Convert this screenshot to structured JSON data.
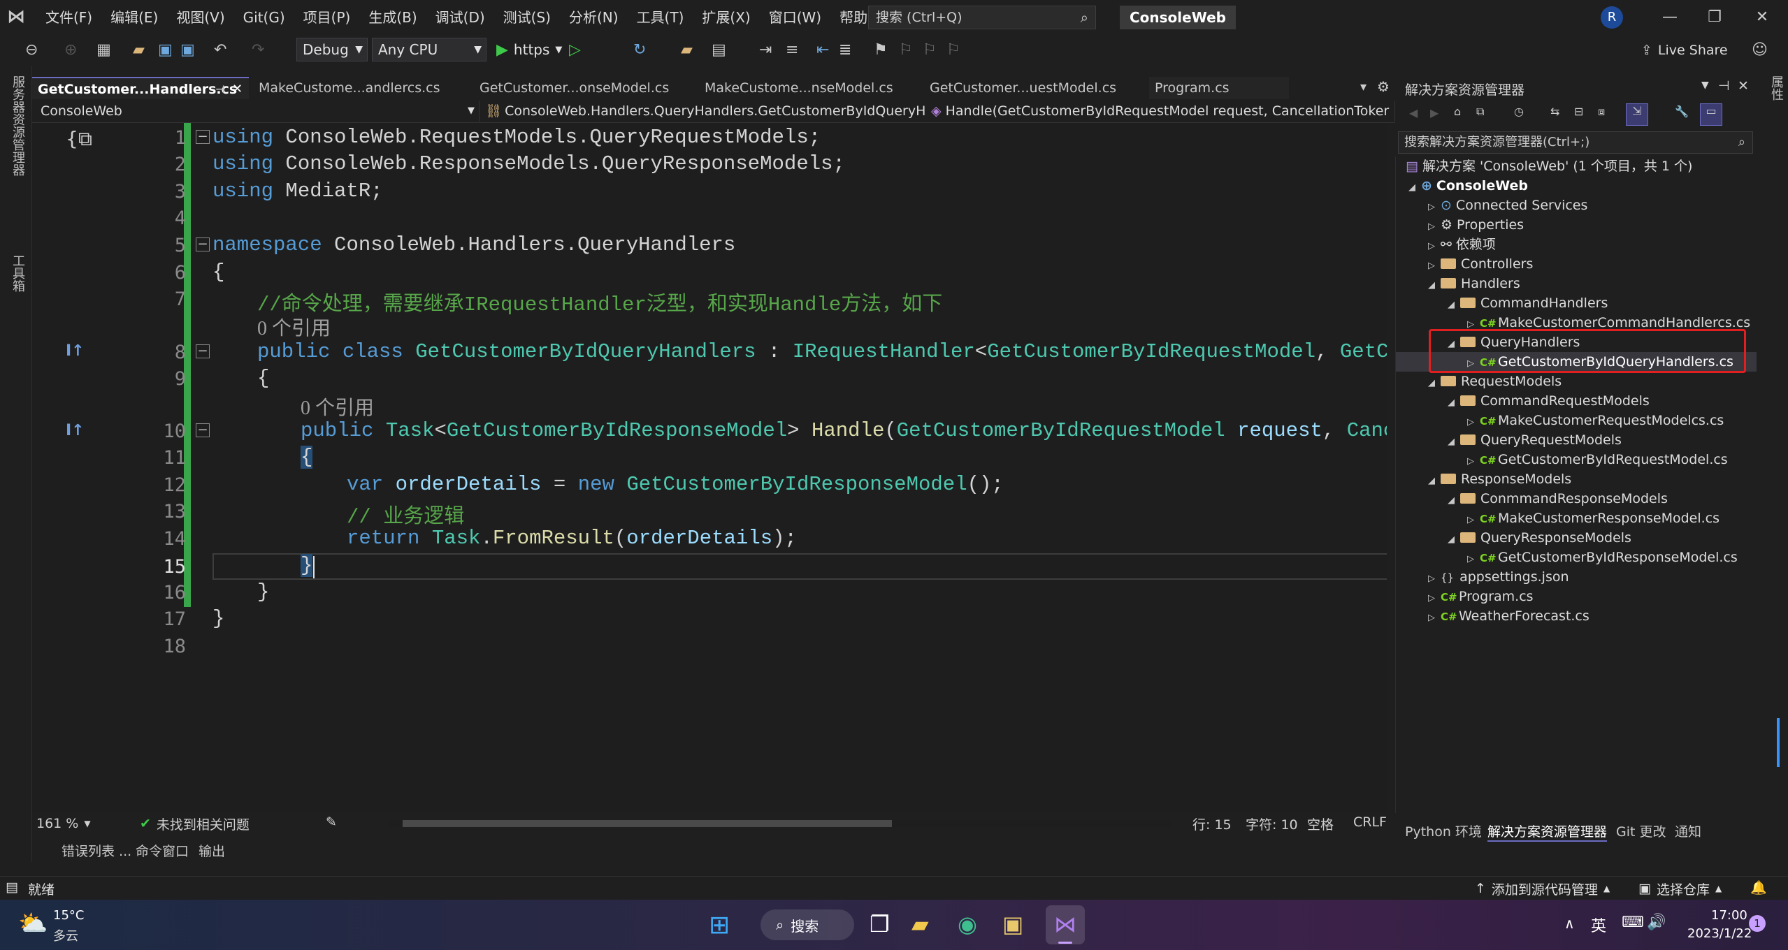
{
  "menubar": {
    "items": [
      "文件(F)",
      "编辑(E)",
      "视图(V)",
      "Git(G)",
      "项目(P)",
      "生成(B)",
      "调试(D)",
      "测试(S)",
      "分析(N)",
      "工具(T)",
      "扩展(X)",
      "窗口(W)",
      "帮助(H)"
    ],
    "search_placeholder": "搜索 (Ctrl+Q)",
    "solution_name": "ConsoleWeb",
    "avatar_letter": "R",
    "live_share": "Live Share"
  },
  "toolbar": {
    "config": "Debug",
    "platform": "Any CPU",
    "run_target": "https"
  },
  "left_strip": {
    "item1": "服务器资源管理器",
    "item2": "工具箱"
  },
  "right_strip": {
    "item1": "属性"
  },
  "tabs": [
    {
      "label": "GetCustomer...Handlers.cs"
    },
    {
      "label": "MakeCustome...andlercs.cs"
    },
    {
      "label": "GetCustomer...onseModel.cs"
    },
    {
      "label": "MakeCustome...nseModel.cs"
    },
    {
      "label": "GetCustomer...uestModel.cs"
    },
    {
      "label": "Program.cs"
    }
  ],
  "navbar": {
    "project": "ConsoleWeb",
    "type": "ConsoleWeb.Handlers.QueryHandlers.GetCustomerByIdQueryHand",
    "member": "Handle(GetCustomerByIdRequestModel request, CancellationToker"
  },
  "editor": {
    "line_numbers": [
      "1",
      "2",
      "3",
      "4",
      "5",
      "6",
      "7",
      "8",
      "9",
      "10",
      "11",
      "12",
      "13",
      "14",
      "15",
      "16",
      "17",
      "18"
    ],
    "current_line": "15",
    "ref_count_label": "0 个引用",
    "code": {
      "l1_kw": "using",
      "l1_rest": " ConsoleWeb.RequestModels.QueryRequestModels;",
      "l2_kw": "using",
      "l2_rest": " ConsoleWeb.ResponseModels.QueryResponseModels;",
      "l3_kw": "using",
      "l3_rest": " MediatR;",
      "l5_kw": "namespace",
      "l5_rest": " ConsoleWeb.Handlers.QueryHandlers",
      "l6": "{",
      "l7": "//命令处理，需要继承IRequestHandler泛型，和实现Handle方法，如下",
      "l8_kw1": "public",
      "l8_kw2": " class ",
      "l8_name": "GetCustomerByIdQueryHandlers",
      "l8_sep": " : ",
      "l8_if": "IRequestHandler",
      "l8_lt": "<",
      "l8_t1": "GetCustomerByIdRequestModel",
      "l8_comma": ", ",
      "l8_t2": "GetCustomerB",
      "l9": "{",
      "l10_kw": "public",
      "l10_sp": " ",
      "l10_task": "Task",
      "l10_lt": "<",
      "l10_resp": "GetCustomerByIdResponseModel",
      "l10_gt": "> ",
      "l10_method": "Handle",
      "l10_paren": "(",
      "l10_req": "GetCustomerByIdRequestModel",
      "l10_param": " request",
      "l10_comma": ", ",
      "l10_ct": "Cancellatio",
      "l11": "{",
      "l12_kw": "var",
      "l12_var": " orderDetails",
      "l12_eq": " = ",
      "l12_new": "new",
      "l12_sp": " ",
      "l12_type": "GetCustomerByIdResponseModel",
      "l12_end": "();",
      "l13": "// 业务逻辑",
      "l14_kw": "return",
      "l14_sp": " ",
      "l14_task": "Task",
      "l14_dot": ".",
      "l14_method": "FromResult",
      "l14_open": "(",
      "l14_arg": "orderDetails",
      "l14_end": ");",
      "l15": "}",
      "l16": "}",
      "l17": "}"
    }
  },
  "editor_status": {
    "zoom": "161 %",
    "issues": "未找到相关问题",
    "line": "行: 15",
    "col": "字符: 10",
    "whitespace": "空格",
    "eol": "CRLF"
  },
  "bottom_tabs": [
    "错误列表 ...",
    "命令窗口",
    "输出"
  ],
  "solution_explorer": {
    "title": "解决方案资源管理器",
    "search_placeholder": "搜索解决方案资源管理器(Ctrl+;)",
    "solution_label": "解决方案 'ConsoleWeb' (1 个项目，共 1 个)",
    "project": "ConsoleWeb",
    "nodes": [
      "Connected Services",
      "Properties",
      "依赖项",
      "Controllers",
      "Handlers",
      "CommandHandlers",
      "MakeCustomerCommandHandlercs.cs",
      "QueryHandlers",
      "GetCustomerByIdQueryHandlers.cs",
      "RequestModels",
      "CommandRequestModels",
      "MakeCustomerRequestModelcs.cs",
      "QueryRequestModels",
      "GetCustomerByIdRequestModel.cs",
      "ResponseModels",
      "ConmmandResponseModels",
      "MakeCustomerResponseModel.cs",
      "QueryResponseModels",
      "GetCustomerByIdResponseModel.cs",
      "appsettings.json",
      "Program.cs",
      "WeatherForecast.cs"
    ],
    "cs_prefix": "C#",
    "bottom_tabs": [
      "Python 环境",
      "解决方案资源管理器",
      "Git 更改",
      "通知"
    ]
  },
  "statusbar": {
    "ready": "就绪",
    "add_source": "添加到源代码管理",
    "select_repo": "选择仓库"
  },
  "taskbar": {
    "temperature": "15°C",
    "weather": "多云",
    "search": "搜索",
    "lang": "英",
    "time": "17:00",
    "date": "2023/1/22",
    "notif_count": "1"
  },
  "colors": {
    "accent": "#6c6cc4",
    "change_bar": "#3aa64b",
    "highlight": "#e02020",
    "keyword": "#569cd6",
    "type": "#4ec9b0",
    "comment": "#57a64a"
  }
}
